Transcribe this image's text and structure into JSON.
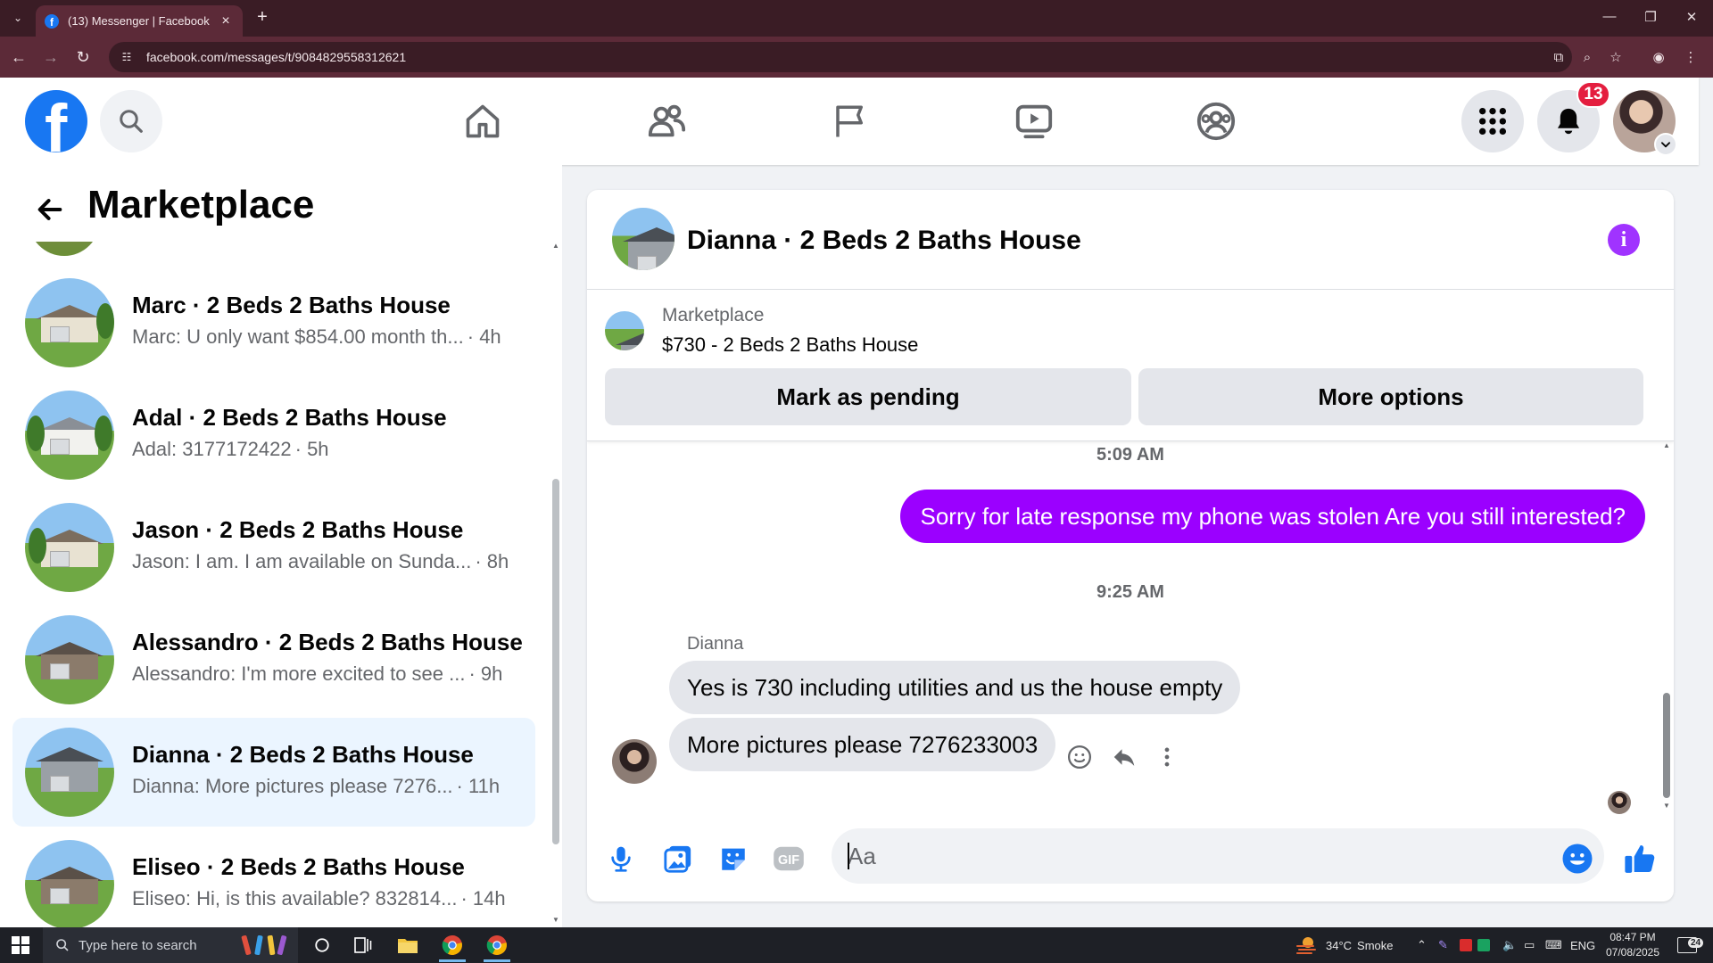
{
  "browser": {
    "tab_title": "(13) Messenger | Facebook",
    "url": "facebook.com/messages/t/9084829558312621"
  },
  "header": {
    "notification_count": "13"
  },
  "sidebar": {
    "title": "Marketplace",
    "conversations": [
      {
        "name": "Marc · 2 Beds 2 Baths House",
        "preview": "Marc: U only want $854.00 month th...",
        "time": "· 4h",
        "active": false
      },
      {
        "name": "Adal · 2 Beds 2 Baths House",
        "preview": "Adal: 3177172422",
        "time": "· 5h",
        "active": false
      },
      {
        "name": "Jason · 2 Beds 2 Baths House",
        "preview": "Jason: I am. I am available on Sunda...",
        "time": "· 8h",
        "active": false
      },
      {
        "name": "Alessandro · 2 Beds 2 Baths House",
        "preview": "Alessandro: I'm more excited to see ...",
        "time": "· 9h",
        "active": false
      },
      {
        "name": "Dianna · 2 Beds 2 Baths House",
        "preview": "Dianna: More pictures please 7276...",
        "time": "· 11h",
        "active": true
      },
      {
        "name": "Eliseo · 2 Beds 2 Baths House",
        "preview": "Eliseo: Hi, is this available? 832814...",
        "time": "· 14h",
        "active": false
      }
    ]
  },
  "chat": {
    "title": "Dianna · 2 Beds 2 Baths House",
    "listing_label": "Marketplace",
    "listing_title": "$730 - 2 Beds 2 Baths House",
    "mark_pending_label": "Mark as pending",
    "more_options_label": "More options",
    "timestamp_1": "5:09 AM",
    "outgoing_message": "Sorry for late response my  phone was stolen Are you still interested?",
    "timestamp_2": "9:25 AM",
    "sender_name": "Dianna",
    "incoming_1": "Yes is 730 including utilities and us the house empty",
    "incoming_2": "More pictures please 7276233003",
    "composer_placeholder": "Aa"
  },
  "taskbar": {
    "search_placeholder": "Type here to search",
    "weather_temp": "34°C",
    "weather_desc": "Smoke",
    "language": "ENG",
    "time": "08:47 PM",
    "date": "07/08/2025",
    "notification_count": "24"
  },
  "colors": {
    "fb_blue": "#1877f2",
    "messenger_purple": "#9b00ff",
    "notification_red": "#e41e3f",
    "browser_frame": "#5c2a38"
  }
}
